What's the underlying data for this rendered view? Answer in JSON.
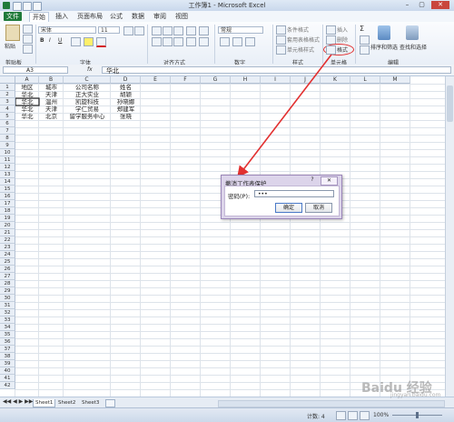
{
  "window": {
    "title": "工作簿1 - Microsoft Excel",
    "min": "–",
    "max": "▢",
    "close": "✕"
  },
  "menu": [
    "文件",
    "开始",
    "插入",
    "页面布局",
    "公式",
    "数据",
    "审阅",
    "视图"
  ],
  "ribbon": {
    "clipboard": {
      "paste": "粘贴",
      "label": "剪贴板"
    },
    "font": {
      "name": "宋体",
      "size": "11",
      "label": "字体",
      "bold": "B",
      "italic": "I",
      "underline": "U"
    },
    "alignment": {
      "label": "对齐方式"
    },
    "number": {
      "label": "数字",
      "format": "常规"
    },
    "styles": {
      "label": "样式",
      "cond": "条件格式",
      "table": "套用表格格式",
      "cell": "单元格样式"
    },
    "cells": {
      "label": "单元格",
      "insert": "插入",
      "delete": "删除",
      "format": "格式"
    },
    "editing": {
      "label": "编辑",
      "sort": "排序和筛选",
      "find": "查找和选择",
      "sum": "Σ"
    }
  },
  "formula_bar": {
    "name_box": "A3",
    "fx": "fx",
    "value": "华北"
  },
  "columns": [
    "A",
    "B",
    "C",
    "D",
    "E",
    "F",
    "G",
    "H",
    "I",
    "J",
    "K",
    "L",
    "M"
  ],
  "rows": [
    "1",
    "2",
    "3",
    "4",
    "5",
    "6",
    "7",
    "8",
    "9",
    "10",
    "11",
    "12",
    "13",
    "14",
    "15",
    "16",
    "17",
    "18",
    "19",
    "20",
    "21",
    "22",
    "23",
    "24",
    "25",
    "26",
    "27",
    "28",
    "29",
    "30",
    "31",
    "32",
    "33",
    "34",
    "35",
    "36",
    "37",
    "38",
    "39",
    "40",
    "41",
    "42"
  ],
  "table": [
    [
      "地区",
      "城市",
      "公司名称",
      "姓名"
    ],
    [
      "华北",
      "天津",
      "正大实业",
      "胡颖"
    ],
    [
      "华北",
      "温州",
      "凯旋科技",
      "孙晓娜"
    ],
    [
      "华北",
      "天津",
      "学仁贸易",
      "郑建军"
    ],
    [
      "华北",
      "北京",
      "留学服务中心",
      "张晓"
    ]
  ],
  "sheets": [
    "Sheet1",
    "Sheet2",
    "Sheet3"
  ],
  "status": {
    "count": "计数: 4",
    "zoom": "100%"
  },
  "dialog": {
    "title": "撤消工作表保护",
    "help": "?",
    "close": "✕",
    "password_label": "密码(P):",
    "password_value": "•••",
    "ok": "确定",
    "cancel": "取消"
  },
  "watermark": {
    "text": "Baidu 经验",
    "url": "jingyan.baidu.com"
  }
}
